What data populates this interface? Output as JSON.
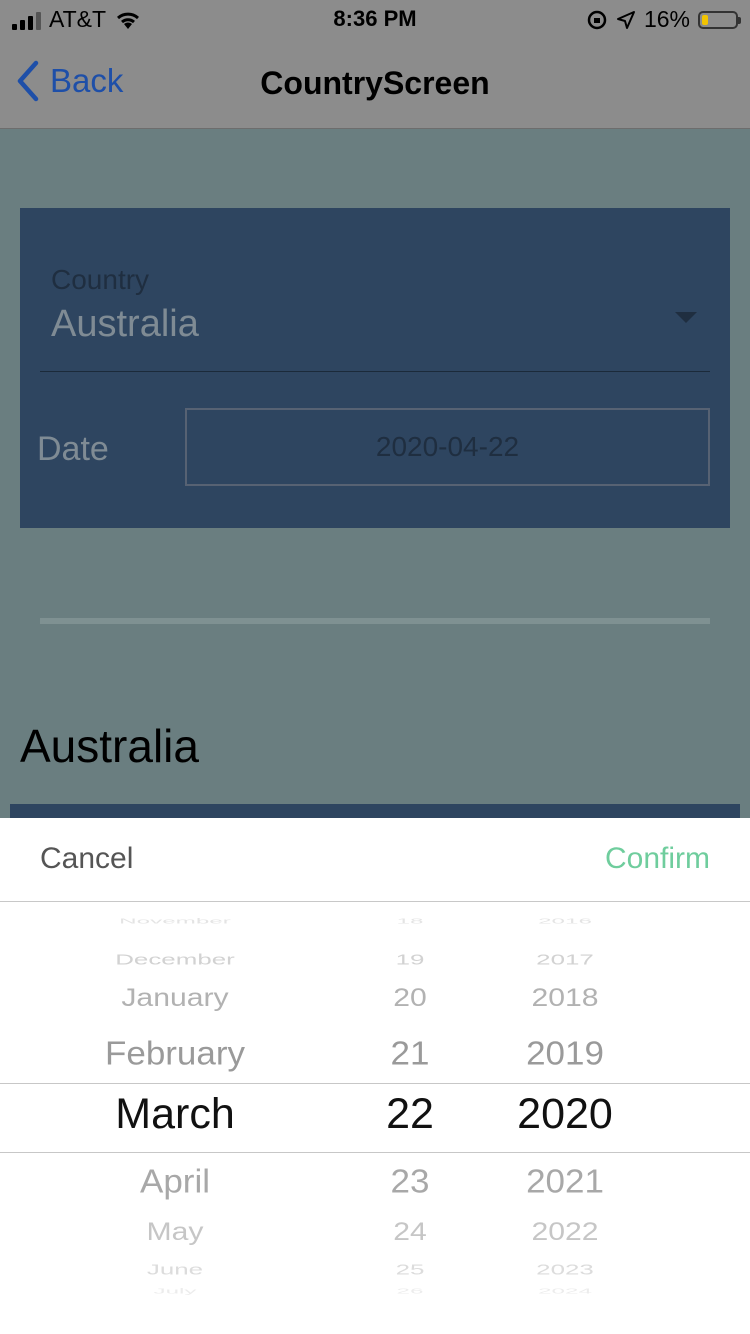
{
  "status_bar": {
    "carrier": "AT&T",
    "time": "8:36 PM",
    "battery": "16%",
    "battery_level": 0.16
  },
  "nav": {
    "back_label": "Back",
    "title": "CountryScreen"
  },
  "form": {
    "country_label": "Country",
    "country_value": "Australia",
    "date_label": "Date",
    "date_value": "2020-04-22"
  },
  "result_text": "Australia",
  "picker": {
    "cancel_label": "Cancel",
    "confirm_label": "Confirm",
    "months": [
      "November",
      "December",
      "January",
      "February",
      "March",
      "April",
      "May",
      "June",
      "July"
    ],
    "days": [
      "18",
      "19",
      "20",
      "21",
      "22",
      "23",
      "24",
      "25",
      "26"
    ],
    "years": [
      "2016",
      "2017",
      "2018",
      "2019",
      "2020",
      "2021",
      "2022",
      "2023",
      "2024"
    ],
    "selected": {
      "month": "March",
      "day": "22",
      "year": "2020"
    }
  },
  "colors": {
    "back_blue": "#1e4fa8",
    "confirm_green": "#6fcd9d",
    "card_blue": "#2e4560"
  }
}
